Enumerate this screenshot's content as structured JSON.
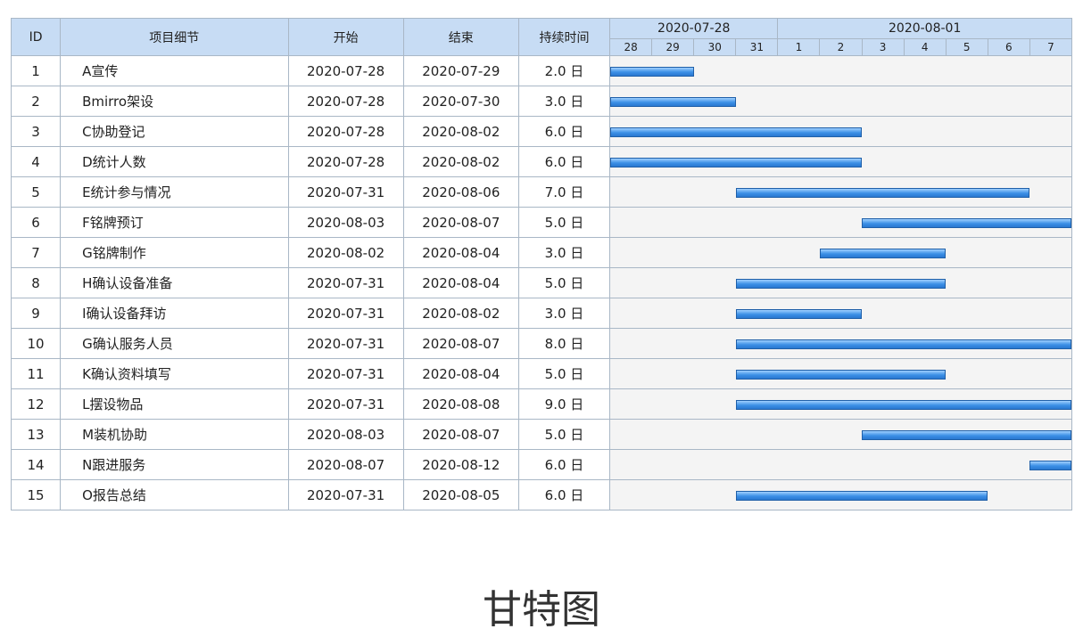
{
  "table": {
    "headers": {
      "id": "ID",
      "detail": "项目细节",
      "start": "开始",
      "end": "结束",
      "duration": "持续时间"
    },
    "periods": [
      "2020-07-28",
      "2020-08-01"
    ],
    "days": [
      "28",
      "29",
      "30",
      "31",
      "1",
      "2",
      "3",
      "4",
      "5",
      "6",
      "7"
    ],
    "rows": [
      {
        "id": "1",
        "detail": "A宣传",
        "start": "2020-07-28",
        "end": "2020-07-29",
        "duration": "2.0 日",
        "bar_start_day": 0,
        "bar_days": 2
      },
      {
        "id": "2",
        "detail": "Bmirro架设",
        "start": "2020-07-28",
        "end": "2020-07-30",
        "duration": "3.0 日",
        "bar_start_day": 0,
        "bar_days": 3
      },
      {
        "id": "3",
        "detail": "C协助登记",
        "start": "2020-07-28",
        "end": "2020-08-02",
        "duration": "6.0 日",
        "bar_start_day": 0,
        "bar_days": 6
      },
      {
        "id": "4",
        "detail": "D统计人数",
        "start": "2020-07-28",
        "end": "2020-08-02",
        "duration": "6.0 日",
        "bar_start_day": 0,
        "bar_days": 6
      },
      {
        "id": "5",
        "detail": "E统计参与情况",
        "start": "2020-07-31",
        "end": "2020-08-06",
        "duration": "7.0 日",
        "bar_start_day": 3,
        "bar_days": 7
      },
      {
        "id": "6",
        "detail": "F铭牌预订",
        "start": "2020-08-03",
        "end": "2020-08-07",
        "duration": "5.0 日",
        "bar_start_day": 6,
        "bar_days": 5
      },
      {
        "id": "7",
        "detail": "G铭牌制作",
        "start": "2020-08-02",
        "end": "2020-08-04",
        "duration": "3.0 日",
        "bar_start_day": 5,
        "bar_days": 3
      },
      {
        "id": "8",
        "detail": "H确认设备准备",
        "start": "2020-07-31",
        "end": "2020-08-04",
        "duration": "5.0 日",
        "bar_start_day": 3,
        "bar_days": 5
      },
      {
        "id": "9",
        "detail": "I确认设备拜访",
        "start": "2020-07-31",
        "end": "2020-08-02",
        "duration": "3.0 日",
        "bar_start_day": 3,
        "bar_days": 3
      },
      {
        "id": "10",
        "detail": "G确认服务人员",
        "start": "2020-07-31",
        "end": "2020-08-07",
        "duration": "8.0 日",
        "bar_start_day": 3,
        "bar_days": 8
      },
      {
        "id": "11",
        "detail": "K确认资料填写",
        "start": "2020-07-31",
        "end": "2020-08-04",
        "duration": "5.0 日",
        "bar_start_day": 3,
        "bar_days": 5
      },
      {
        "id": "12",
        "detail": "L摆设物品",
        "start": "2020-07-31",
        "end": "2020-08-08",
        "duration": "9.0 日",
        "bar_start_day": 3,
        "bar_days": 9
      },
      {
        "id": "13",
        "detail": "M装机协助",
        "start": "2020-08-03",
        "end": "2020-08-07",
        "duration": "5.0 日",
        "bar_start_day": 6,
        "bar_days": 5
      },
      {
        "id": "14",
        "detail": "N跟进服务",
        "start": "2020-08-07",
        "end": "2020-08-12",
        "duration": "6.0 日",
        "bar_start_day": 10,
        "bar_days": 6
      },
      {
        "id": "15",
        "detail": "O报告总结",
        "start": "2020-07-31",
        "end": "2020-08-05",
        "duration": "6.0 日",
        "bar_start_day": 3,
        "bar_days": 6
      }
    ]
  },
  "caption": "甘特图",
  "colors": {
    "header_bg": "#c7dcf4",
    "bar_fill": "#3b8fe6",
    "bar_border": "#1f5fa8",
    "grid": "#a9b7c6"
  }
}
